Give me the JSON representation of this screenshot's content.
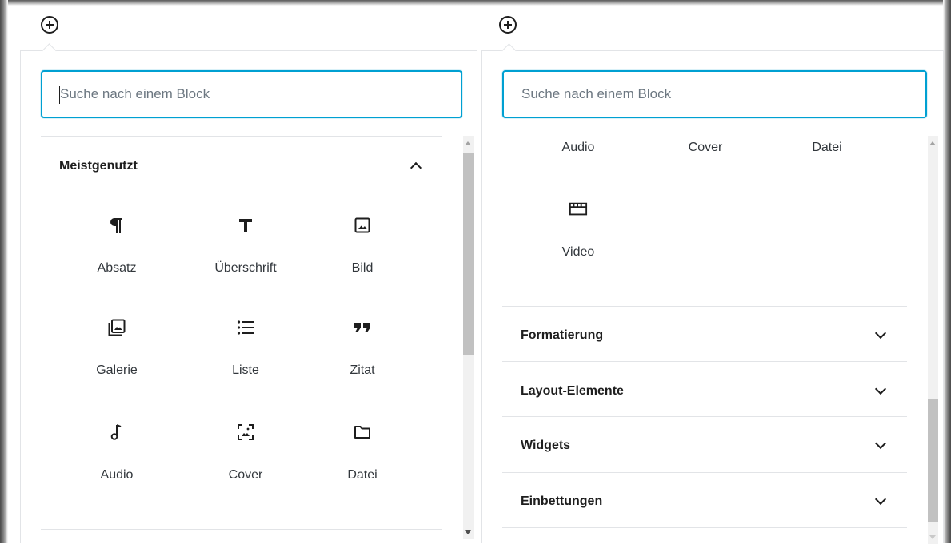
{
  "search": {
    "placeholder": "Suche nach einem Block"
  },
  "left_panel": {
    "section_title": "Meistgenutzt",
    "blocks": [
      {
        "label": "Absatz",
        "icon": "paragraph-icon"
      },
      {
        "label": "Überschrift",
        "icon": "heading-icon"
      },
      {
        "label": "Bild",
        "icon": "image-icon"
      },
      {
        "label": "Galerie",
        "icon": "gallery-icon"
      },
      {
        "label": "Liste",
        "icon": "list-icon"
      },
      {
        "label": "Zitat",
        "icon": "quote-icon"
      },
      {
        "label": "Audio",
        "icon": "audio-icon"
      },
      {
        "label": "Cover",
        "icon": "cover-icon"
      },
      {
        "label": "Datei",
        "icon": "file-icon"
      }
    ]
  },
  "right_panel": {
    "top_labels": [
      {
        "label": "Audio"
      },
      {
        "label": "Cover"
      },
      {
        "label": "Datei"
      }
    ],
    "video": {
      "label": "Video",
      "icon": "video-icon"
    },
    "categories": [
      {
        "label": "Formatierung"
      },
      {
        "label": "Layout-Elemente"
      },
      {
        "label": "Widgets"
      },
      {
        "label": "Einbettungen"
      }
    ]
  },
  "colors": {
    "focus": "#00a0d2",
    "text": "#1e1e1e",
    "border": "#e2e4e7"
  }
}
